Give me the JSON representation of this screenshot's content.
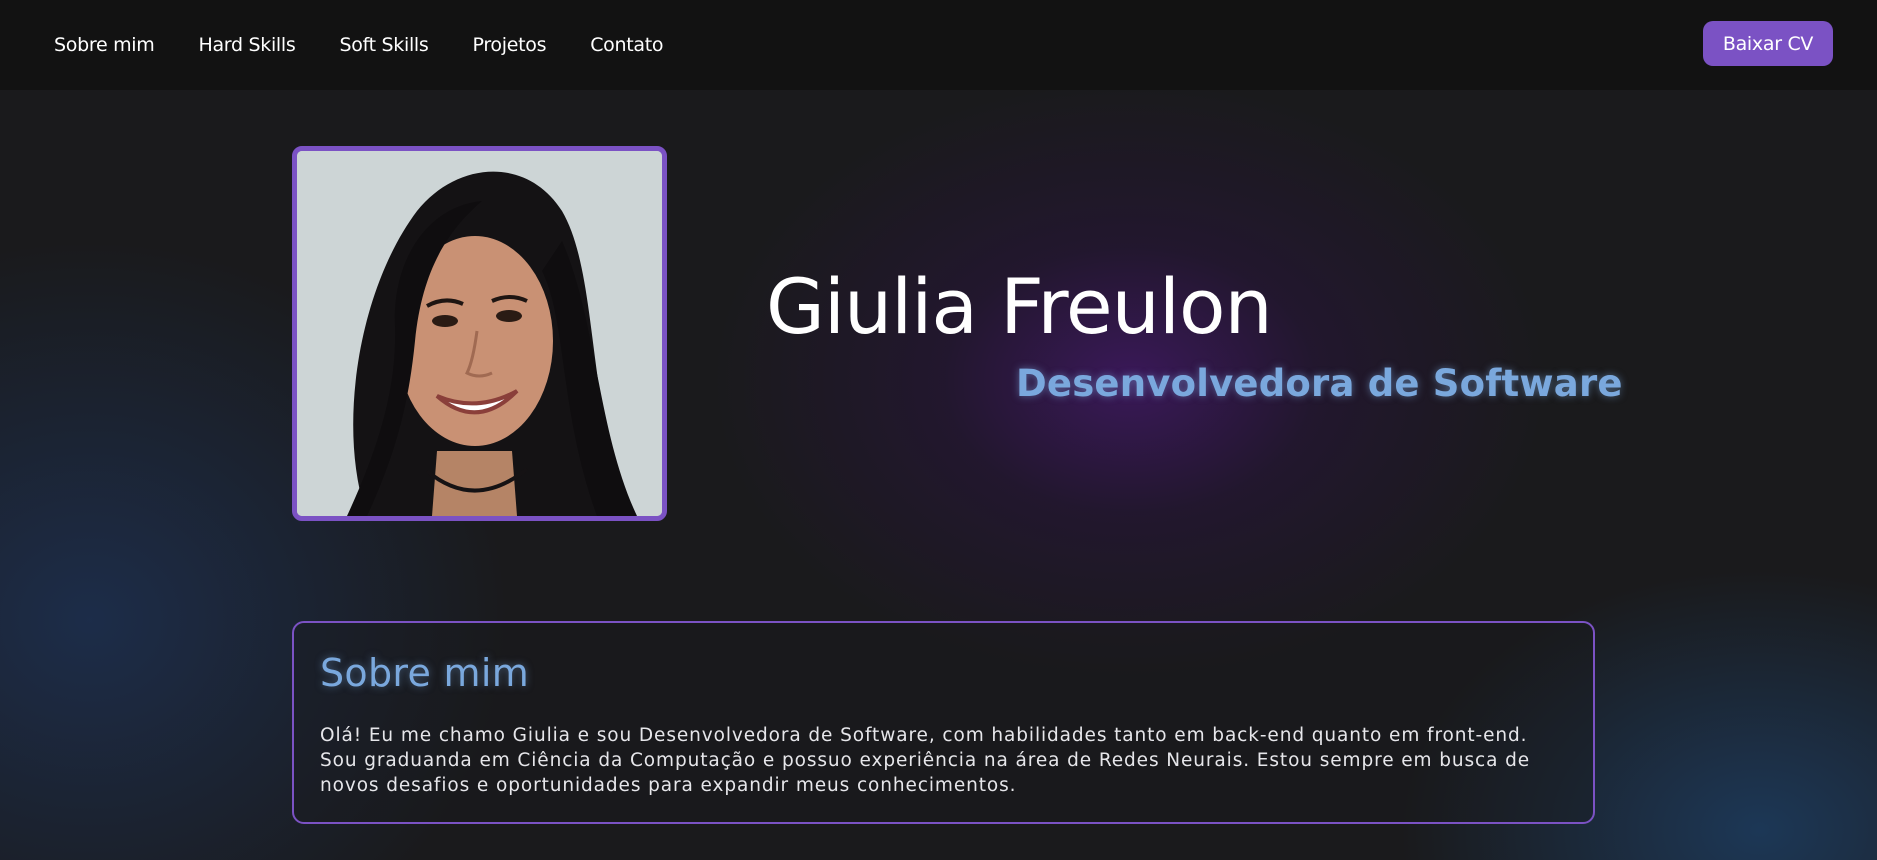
{
  "nav": {
    "links": [
      "Sobre mim",
      "Hard Skills",
      "Soft Skills",
      "Projetos",
      "Contato"
    ],
    "cv_button": "Baixar CV"
  },
  "hero": {
    "name": "Giulia Freulon",
    "role": "Desenvolvedora de Software",
    "photo_icon": "profile-photo"
  },
  "about": {
    "title": "Sobre mim",
    "text": "Olá! Eu me chamo Giulia e sou Desenvolvedora de Software, com habilidades tanto em back-end quanto em front-end. Sou graduanda em Ciência da Computação e possuo experiência na área de Redes Neurais. Estou sempre em busca de novos desafios e oportunidades para expandir meus conhecimentos."
  },
  "colors": {
    "accent": "#7b52c4",
    "highlight": "#7aa8dd",
    "navbar": "#121212",
    "background": "#1a1a1c"
  }
}
